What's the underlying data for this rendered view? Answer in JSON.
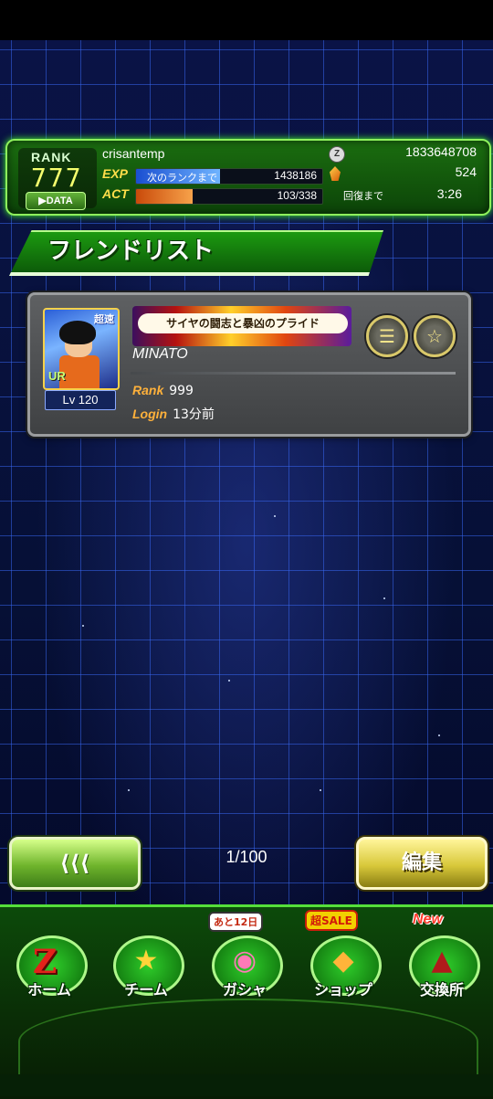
{
  "header": {
    "rank_label": "RANK",
    "rank_value": "777",
    "data_button": "▶DATA",
    "username": "crisantemp",
    "exp_label": "EXP",
    "exp_sub": "次のランクまで",
    "exp_value": "1438186",
    "exp_progress": 0.45,
    "act_label": "ACT",
    "act_value": "103/338",
    "act_progress": 0.305,
    "zeni_value": "1833648708",
    "stones_value": "524",
    "recover_label": "回復まで",
    "recover_time": "3:26"
  },
  "page_title": "フレンドリスト",
  "friend": {
    "leader_skill": "サイヤの闘志と暴凶のプライド",
    "name": "MINATO",
    "type_badge": "超速",
    "rarity": "UR",
    "level": "Lv 120",
    "rank_label": "Rank",
    "rank_value": "999",
    "login_label": "Login",
    "login_value": "13分前"
  },
  "pager": {
    "back_label": "⟨⟨⟨",
    "page_text": "1/100",
    "edit_label": "編集"
  },
  "nav": {
    "home": "ホーム",
    "team": "チーム",
    "gasha": "ガシャ",
    "gasha_badge": "あと12日",
    "shop": "ショップ",
    "shop_badge": "超SALE",
    "exchange": "交換所",
    "exchange_badge": "New"
  },
  "colors": {
    "accent_green": "#55e03a",
    "rank_yellow": "#f5ff6e",
    "label_orange": "#ffb13b"
  },
  "icons": [
    "zeni-icon",
    "dragon-stone-icon",
    "list-icon",
    "star-icon",
    "z-logo-icon",
    "team-icon",
    "gasha-capsule-icon",
    "shop-stone-icon",
    "exchange-icon"
  ]
}
